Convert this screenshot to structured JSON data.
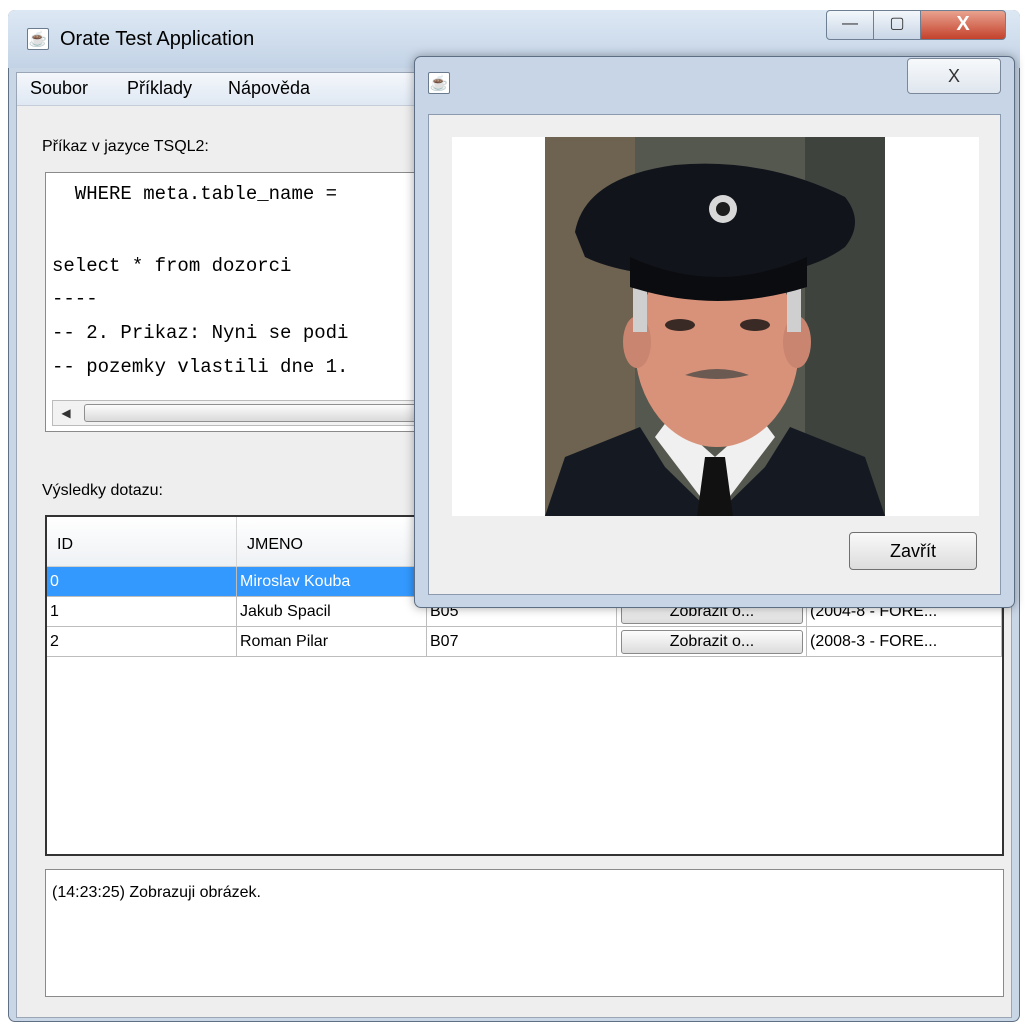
{
  "window": {
    "title": "Orate Test Application",
    "minimize": "—",
    "maximize": "▢",
    "close": "X"
  },
  "menu": [
    {
      "label": "Soubor"
    },
    {
      "label": "Příklady"
    },
    {
      "label": "Nápověda"
    }
  ],
  "query": {
    "label": "Příkaz v jazyce TSQL2:",
    "lines": [
      "  WHERE meta.table_name =",
      "",
      "select * from dozorci",
      "----",
      "-- 2. Prikaz: Nyni se podi",
      "-- pozemky vlastili dne 1."
    ],
    "scroll_left": "◀"
  },
  "results": {
    "label": "Výsledky dotazu:",
    "columns": [
      "ID",
      "JMENO"
    ],
    "rows": [
      {
        "id": "0",
        "name": "Miroslav Kouba",
        "code": "",
        "button": "",
        "period": ""
      },
      {
        "id": "1",
        "name": "Jakub Spacil",
        "code": "B05",
        "button": "Zobrazit o...",
        "period": "(2004-8 - FORE..."
      },
      {
        "id": "2",
        "name": "Roman Pilar",
        "code": "B07",
        "button": "Zobrazit o...",
        "period": "(2008-3 - FORE..."
      }
    ]
  },
  "log": {
    "text": "(14:23:25) Zobrazuji obrázek."
  },
  "dialog": {
    "close_x": "X",
    "button": "Zavřít"
  },
  "icons": {
    "app": "java-icon",
    "dialog": "java-icon"
  }
}
